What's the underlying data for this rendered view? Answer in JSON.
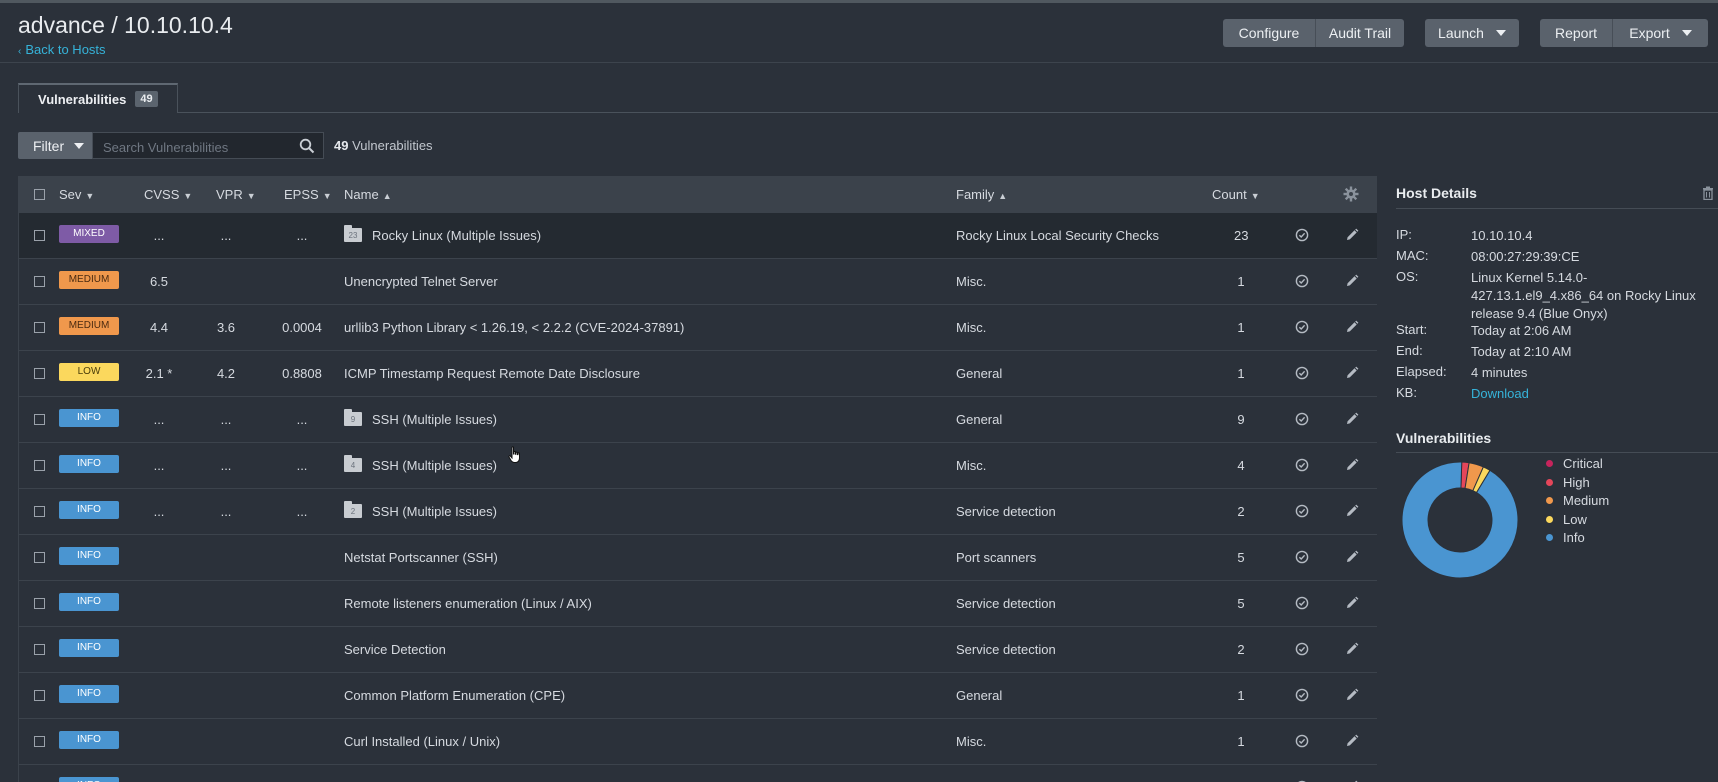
{
  "header": {
    "title": "advance / 10.10.10.4",
    "back_link": "Back to Hosts",
    "buttons": {
      "configure": "Configure",
      "audit_trail": "Audit Trail",
      "launch": "Launch",
      "report": "Report",
      "export": "Export"
    }
  },
  "tabs": [
    {
      "label": "Vulnerabilities",
      "count": "49"
    }
  ],
  "filter": {
    "label": "Filter",
    "search_placeholder": "Search Vulnerabilities",
    "count": "49",
    "count_label": "Vulnerabilities"
  },
  "table": {
    "columns": {
      "sev": "Sev",
      "cvss": "CVSS",
      "vpr": "VPR",
      "epss": "EPSS",
      "name": "Name",
      "family": "Family",
      "count": "Count"
    },
    "rows": [
      {
        "sev": "MIXED",
        "sev_color": "#7e5ba6",
        "sev_text": "#ffffff",
        "cvss": "...",
        "vpr": "...",
        "epss": "...",
        "group": "23",
        "name": "Rocky Linux (Multiple Issues)",
        "family": "Rocky Linux Local Security Checks",
        "count": "23"
      },
      {
        "sev": "MEDIUM",
        "sev_color": "#f0984c",
        "sev_text": "#4a2a10",
        "cvss": "6.5",
        "vpr": "",
        "epss": "",
        "group": "",
        "name": "Unencrypted Telnet Server",
        "family": "Misc.",
        "count": "1"
      },
      {
        "sev": "MEDIUM",
        "sev_color": "#f0984c",
        "sev_text": "#4a2a10",
        "cvss": "4.4",
        "vpr": "3.6",
        "epss": "0.0004",
        "group": "",
        "name": "urllib3 Python Library < 1.26.19, < 2.2.2 (CVE-2024-37891)",
        "family": "Misc.",
        "count": "1"
      },
      {
        "sev": "LOW",
        "sev_color": "#fbd85d",
        "sev_text": "#4a3d0a",
        "cvss": "2.1 *",
        "vpr": "4.2",
        "epss": "0.8808",
        "group": "",
        "name": "ICMP Timestamp Request Remote Date Disclosure",
        "family": "General",
        "count": "1"
      },
      {
        "sev": "INFO",
        "sev_color": "#4a95d1",
        "sev_text": "#ffffff",
        "cvss": "...",
        "vpr": "...",
        "epss": "...",
        "group": "9",
        "name": "SSH (Multiple Issues)",
        "family": "General",
        "count": "9"
      },
      {
        "sev": "INFO",
        "sev_color": "#4a95d1",
        "sev_text": "#ffffff",
        "cvss": "...",
        "vpr": "...",
        "epss": "...",
        "group": "4",
        "name": "SSH (Multiple Issues)",
        "family": "Misc.",
        "count": "4"
      },
      {
        "sev": "INFO",
        "sev_color": "#4a95d1",
        "sev_text": "#ffffff",
        "cvss": "...",
        "vpr": "...",
        "epss": "...",
        "group": "2",
        "name": "SSH (Multiple Issues)",
        "family": "Service detection",
        "count": "2"
      },
      {
        "sev": "INFO",
        "sev_color": "#4a95d1",
        "sev_text": "#ffffff",
        "cvss": "",
        "vpr": "",
        "epss": "",
        "group": "",
        "name": "Netstat Portscanner (SSH)",
        "family": "Port scanners",
        "count": "5"
      },
      {
        "sev": "INFO",
        "sev_color": "#4a95d1",
        "sev_text": "#ffffff",
        "cvss": "",
        "vpr": "",
        "epss": "",
        "group": "",
        "name": "Remote listeners enumeration (Linux / AIX)",
        "family": "Service detection",
        "count": "5"
      },
      {
        "sev": "INFO",
        "sev_color": "#4a95d1",
        "sev_text": "#ffffff",
        "cvss": "",
        "vpr": "",
        "epss": "",
        "group": "",
        "name": "Service Detection",
        "family": "Service detection",
        "count": "2"
      },
      {
        "sev": "INFO",
        "sev_color": "#4a95d1",
        "sev_text": "#ffffff",
        "cvss": "",
        "vpr": "",
        "epss": "",
        "group": "",
        "name": "Common Platform Enumeration (CPE)",
        "family": "General",
        "count": "1"
      },
      {
        "sev": "INFO",
        "sev_color": "#4a95d1",
        "sev_text": "#ffffff",
        "cvss": "",
        "vpr": "",
        "epss": "",
        "group": "",
        "name": "Curl Installed (Linux / Unix)",
        "family": "Misc.",
        "count": "1"
      },
      {
        "sev": "INFO",
        "sev_color": "#4a95d1",
        "sev_text": "#ffffff",
        "cvss": "",
        "vpr": "",
        "epss": "",
        "group": "",
        "name": "",
        "family": "",
        "count": ""
      }
    ]
  },
  "host_details": {
    "title": "Host Details",
    "fields": [
      {
        "key": "IP:",
        "value": "10.10.10.4"
      },
      {
        "key": "MAC:",
        "value": "08:00:27:29:39:CE"
      },
      {
        "key": "OS:",
        "value": "Linux Kernel 5.14.0-427.13.1.el9_4.x86_64 on Rocky Linux release 9.4 (Blue Onyx)"
      },
      {
        "key": "Start:",
        "value": "Today at 2:06 AM"
      },
      {
        "key": "End:",
        "value": "Today at 2:10 AM"
      },
      {
        "key": "Elapsed:",
        "value": "4 minutes"
      },
      {
        "key": "KB:",
        "value": "Download",
        "link": true
      }
    ]
  },
  "vulnerabilities_panel": {
    "title": "Vulnerabilities",
    "legend": [
      {
        "label": "Critical",
        "color": "#c6245c"
      },
      {
        "label": "High",
        "color": "#e5465a"
      },
      {
        "label": "Medium",
        "color": "#f0984c"
      },
      {
        "label": "Low",
        "color": "#fbd85d"
      },
      {
        "label": "Info",
        "color": "#4a95d1"
      }
    ],
    "slices": [
      {
        "label": "High",
        "value": 1,
        "color": "#e5465a"
      },
      {
        "label": "Medium",
        "value": 2,
        "color": "#f0984c"
      },
      {
        "label": "Low",
        "value": 1,
        "color": "#fbd85d"
      },
      {
        "label": "Info",
        "value": 45,
        "color": "#4a95d1"
      }
    ]
  }
}
